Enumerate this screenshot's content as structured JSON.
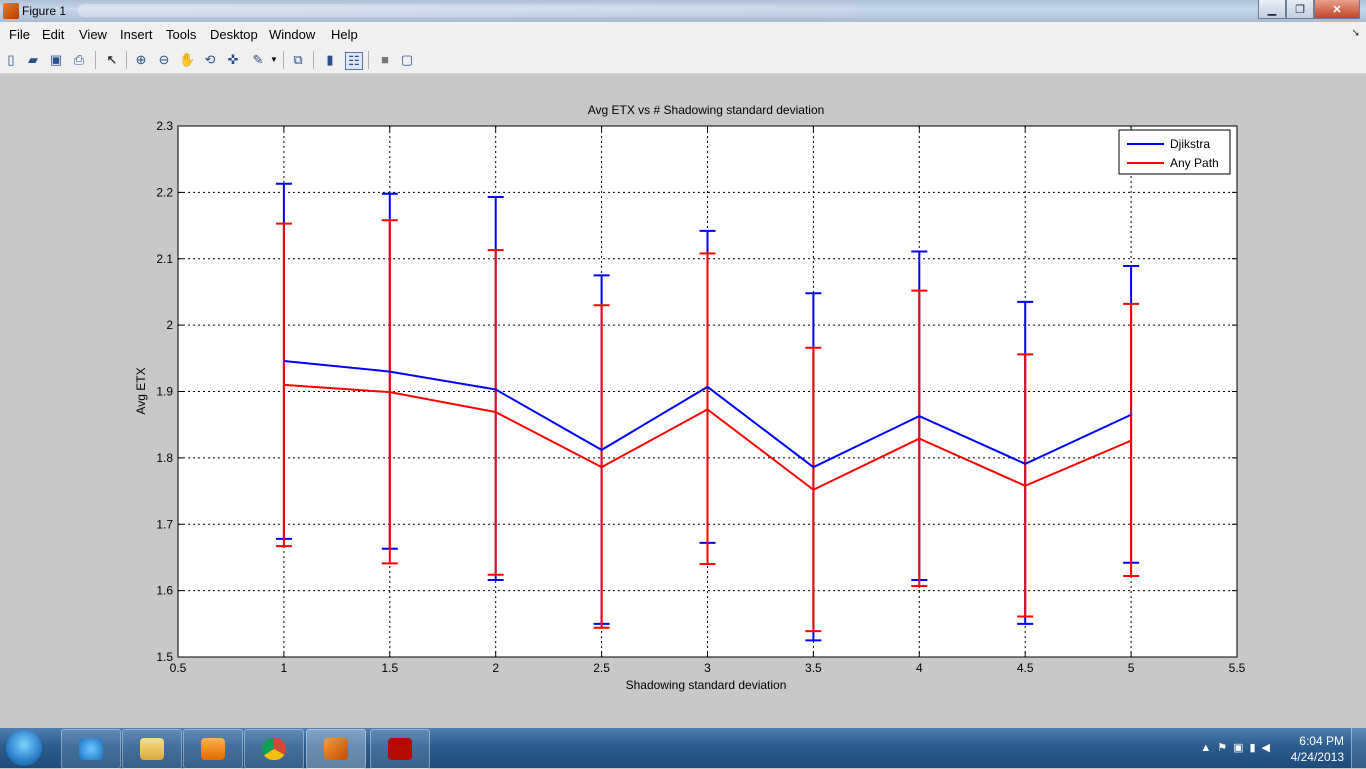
{
  "window": {
    "title": "Figure 1"
  },
  "menu": [
    "File",
    "Edit",
    "View",
    "Insert",
    "Tools",
    "Desktop",
    "Window",
    "Help"
  ],
  "toolbar_icons": [
    "new-figure-icon",
    "open-file-icon",
    "save-icon",
    "print-icon",
    "pointer-icon",
    "zoom-in-icon",
    "zoom-out-icon",
    "pan-icon",
    "rotate-icon",
    "data-cursor-icon",
    "brush-icon",
    "link-plot-icon",
    "colorbar-icon",
    "legend-icon",
    "hide-plot-tools-icon",
    "show-plot-tools-icon"
  ],
  "taskbar": {
    "apps": [
      "internet-explorer-icon",
      "file-explorer-icon",
      "media-player-icon",
      "chrome-icon",
      "matlab-icon",
      "acrobat-icon"
    ],
    "time": "6:04 PM",
    "date": "4/24/2013"
  },
  "chart_data": {
    "type": "line",
    "title": "Avg ETX vs # Shadowing standard deviation",
    "xlabel": "Shadowing standard deviation",
    "ylabel": "Avg ETX",
    "xlim": [
      0.5,
      5.5
    ],
    "ylim": [
      1.5,
      2.3
    ],
    "xticks": [
      "0.5",
      "1",
      "1.5",
      "2",
      "2.5",
      "3",
      "3.5",
      "4",
      "4.5",
      "5",
      "5.5"
    ],
    "yticks": [
      "1.5",
      "1.6",
      "1.7",
      "1.8",
      "1.9",
      "2",
      "2.1",
      "2.2",
      "2.3"
    ],
    "grid": true,
    "legend_position": "top-right",
    "errorbars": true,
    "x": [
      1,
      1.5,
      2,
      2.5,
      3,
      3.5,
      4,
      4.5,
      5
    ],
    "series": [
      {
        "name": "Djikstra",
        "color": "#0000ff",
        "values": [
          1.946,
          1.93,
          1.903,
          1.812,
          1.907,
          1.786,
          1.863,
          1.791,
          1.865
        ],
        "upper": [
          2.213,
          2.198,
          2.193,
          2.075,
          2.142,
          2.048,
          2.111,
          2.035,
          2.089
        ],
        "lower": [
          1.678,
          1.663,
          1.616,
          1.55,
          1.672,
          1.525,
          1.616,
          1.55,
          1.642
        ]
      },
      {
        "name": "Any Path",
        "color": "#ff0000",
        "values": [
          1.91,
          1.899,
          1.869,
          1.786,
          1.873,
          1.752,
          1.829,
          1.758,
          1.826
        ],
        "upper": [
          2.153,
          2.158,
          2.113,
          2.03,
          2.108,
          1.966,
          2.052,
          1.956,
          2.032
        ],
        "lower": [
          1.667,
          1.641,
          1.624,
          1.544,
          1.64,
          1.539,
          1.607,
          1.561,
          1.622
        ]
      }
    ]
  }
}
